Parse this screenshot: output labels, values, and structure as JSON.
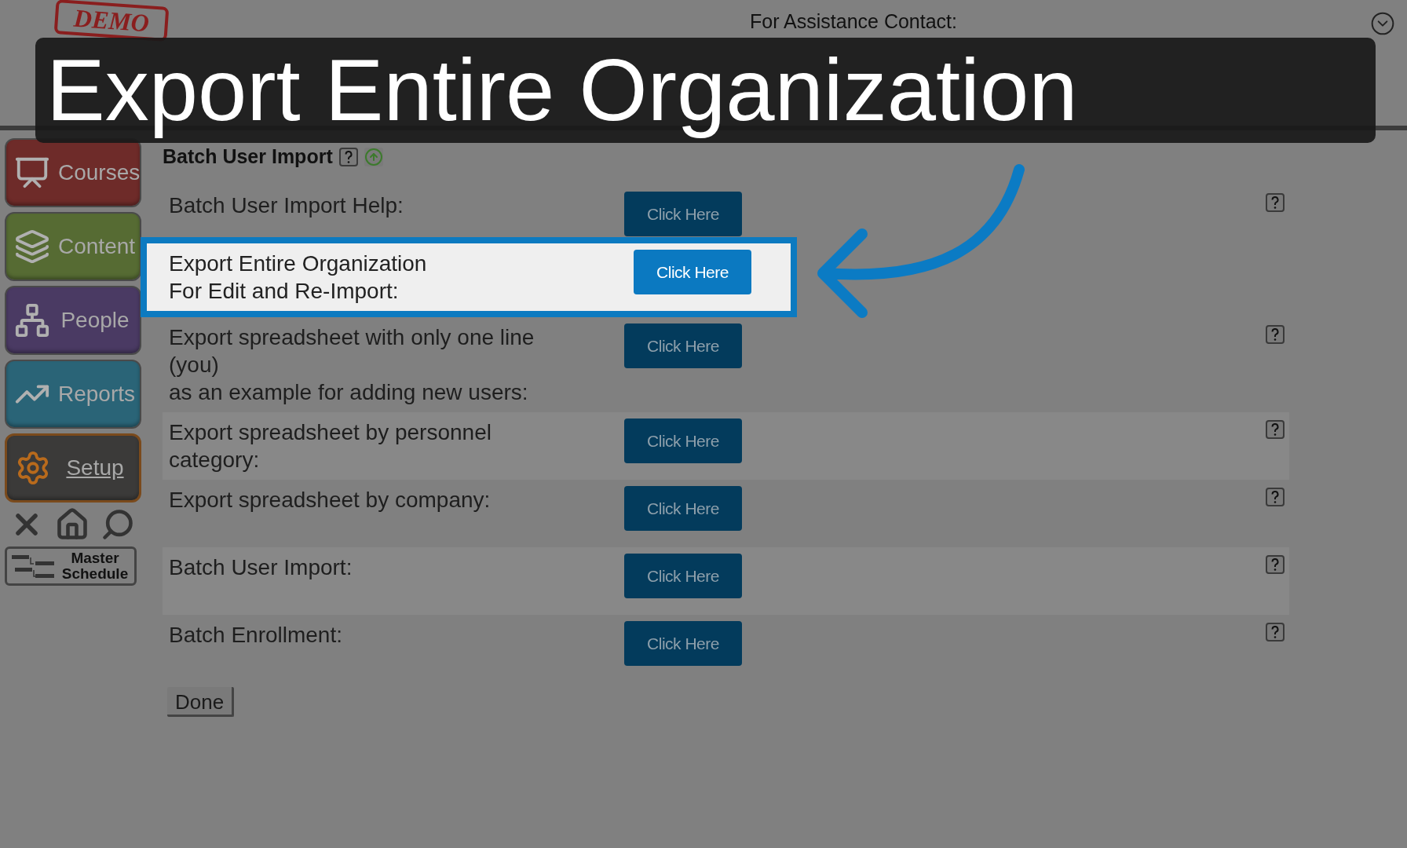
{
  "logo_stamp": "DEMO",
  "assistance": {
    "label": "For Assistance Contact:"
  },
  "banner": {
    "title": "Export Entire Organization"
  },
  "sidebar": {
    "items": [
      {
        "label": "Courses",
        "kind": "courses",
        "selected": false
      },
      {
        "label": "Content",
        "kind": "content",
        "selected": false
      },
      {
        "label": "People",
        "kind": "people",
        "selected": false
      },
      {
        "label": "Reports",
        "kind": "reports",
        "selected": false
      },
      {
        "label": "Setup",
        "kind": "setup",
        "selected": true
      }
    ],
    "master_schedule": "Master\nSchedule"
  },
  "section_title": "Batch User Import",
  "rows": [
    {
      "label": "Batch User Import Help:",
      "button": "Click Here",
      "highlighted": false
    },
    {
      "label": "Export Entire Organization\nFor Edit and Re-Import:",
      "button": "Click Here",
      "highlighted": true
    },
    {
      "label": "Export spreadsheet with only one line\n(you)\nas an example for adding new users:",
      "button": "Click Here",
      "highlighted": false
    },
    {
      "label": "Export spreadsheet by personnel\ncategory:",
      "button": "Click Here",
      "highlighted": false
    },
    {
      "label": "Export spreadsheet by company:",
      "button": "Click Here",
      "highlighted": false
    },
    {
      "label": "Batch User Import:",
      "button": "Click Here",
      "highlighted": false
    },
    {
      "label": "Batch Enrollment:",
      "button": "Click Here",
      "highlighted": false
    }
  ],
  "done_button": "Done"
}
